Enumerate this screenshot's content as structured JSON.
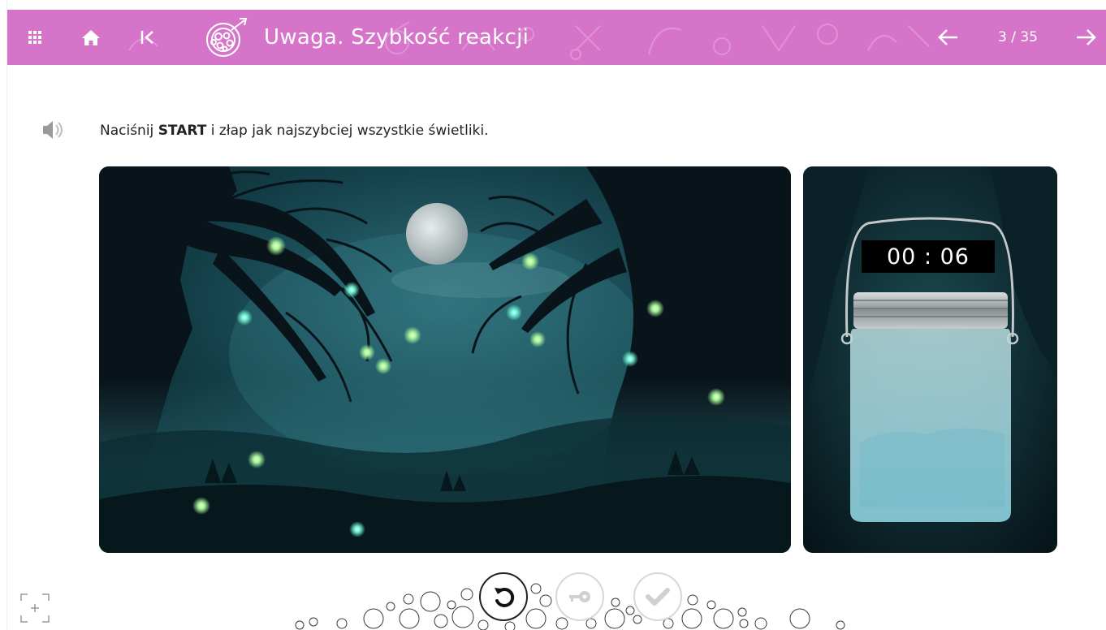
{
  "header": {
    "title": "Uwaga. Szybkość reakcji",
    "counter": "3 / 35",
    "icons": [
      "grid-menu-icon",
      "home-icon",
      "first-page-icon",
      "target-icon",
      "arrow-left-icon",
      "arrow-right-icon"
    ]
  },
  "instruction": {
    "before": "Naciśnij ",
    "bold": "START",
    "after": " i złap jak najszybciej wszystkie świetliki."
  },
  "timer": {
    "value": "00 : 06"
  },
  "controls": {
    "icons": [
      "reset-icon",
      "key-icon",
      "check-icon",
      "fullscreen-icon",
      "speaker-icon"
    ]
  },
  "colors": {
    "header": "#d674c9",
    "scene_bg": "#0b2a33",
    "firefly": "#9cf0a0"
  }
}
